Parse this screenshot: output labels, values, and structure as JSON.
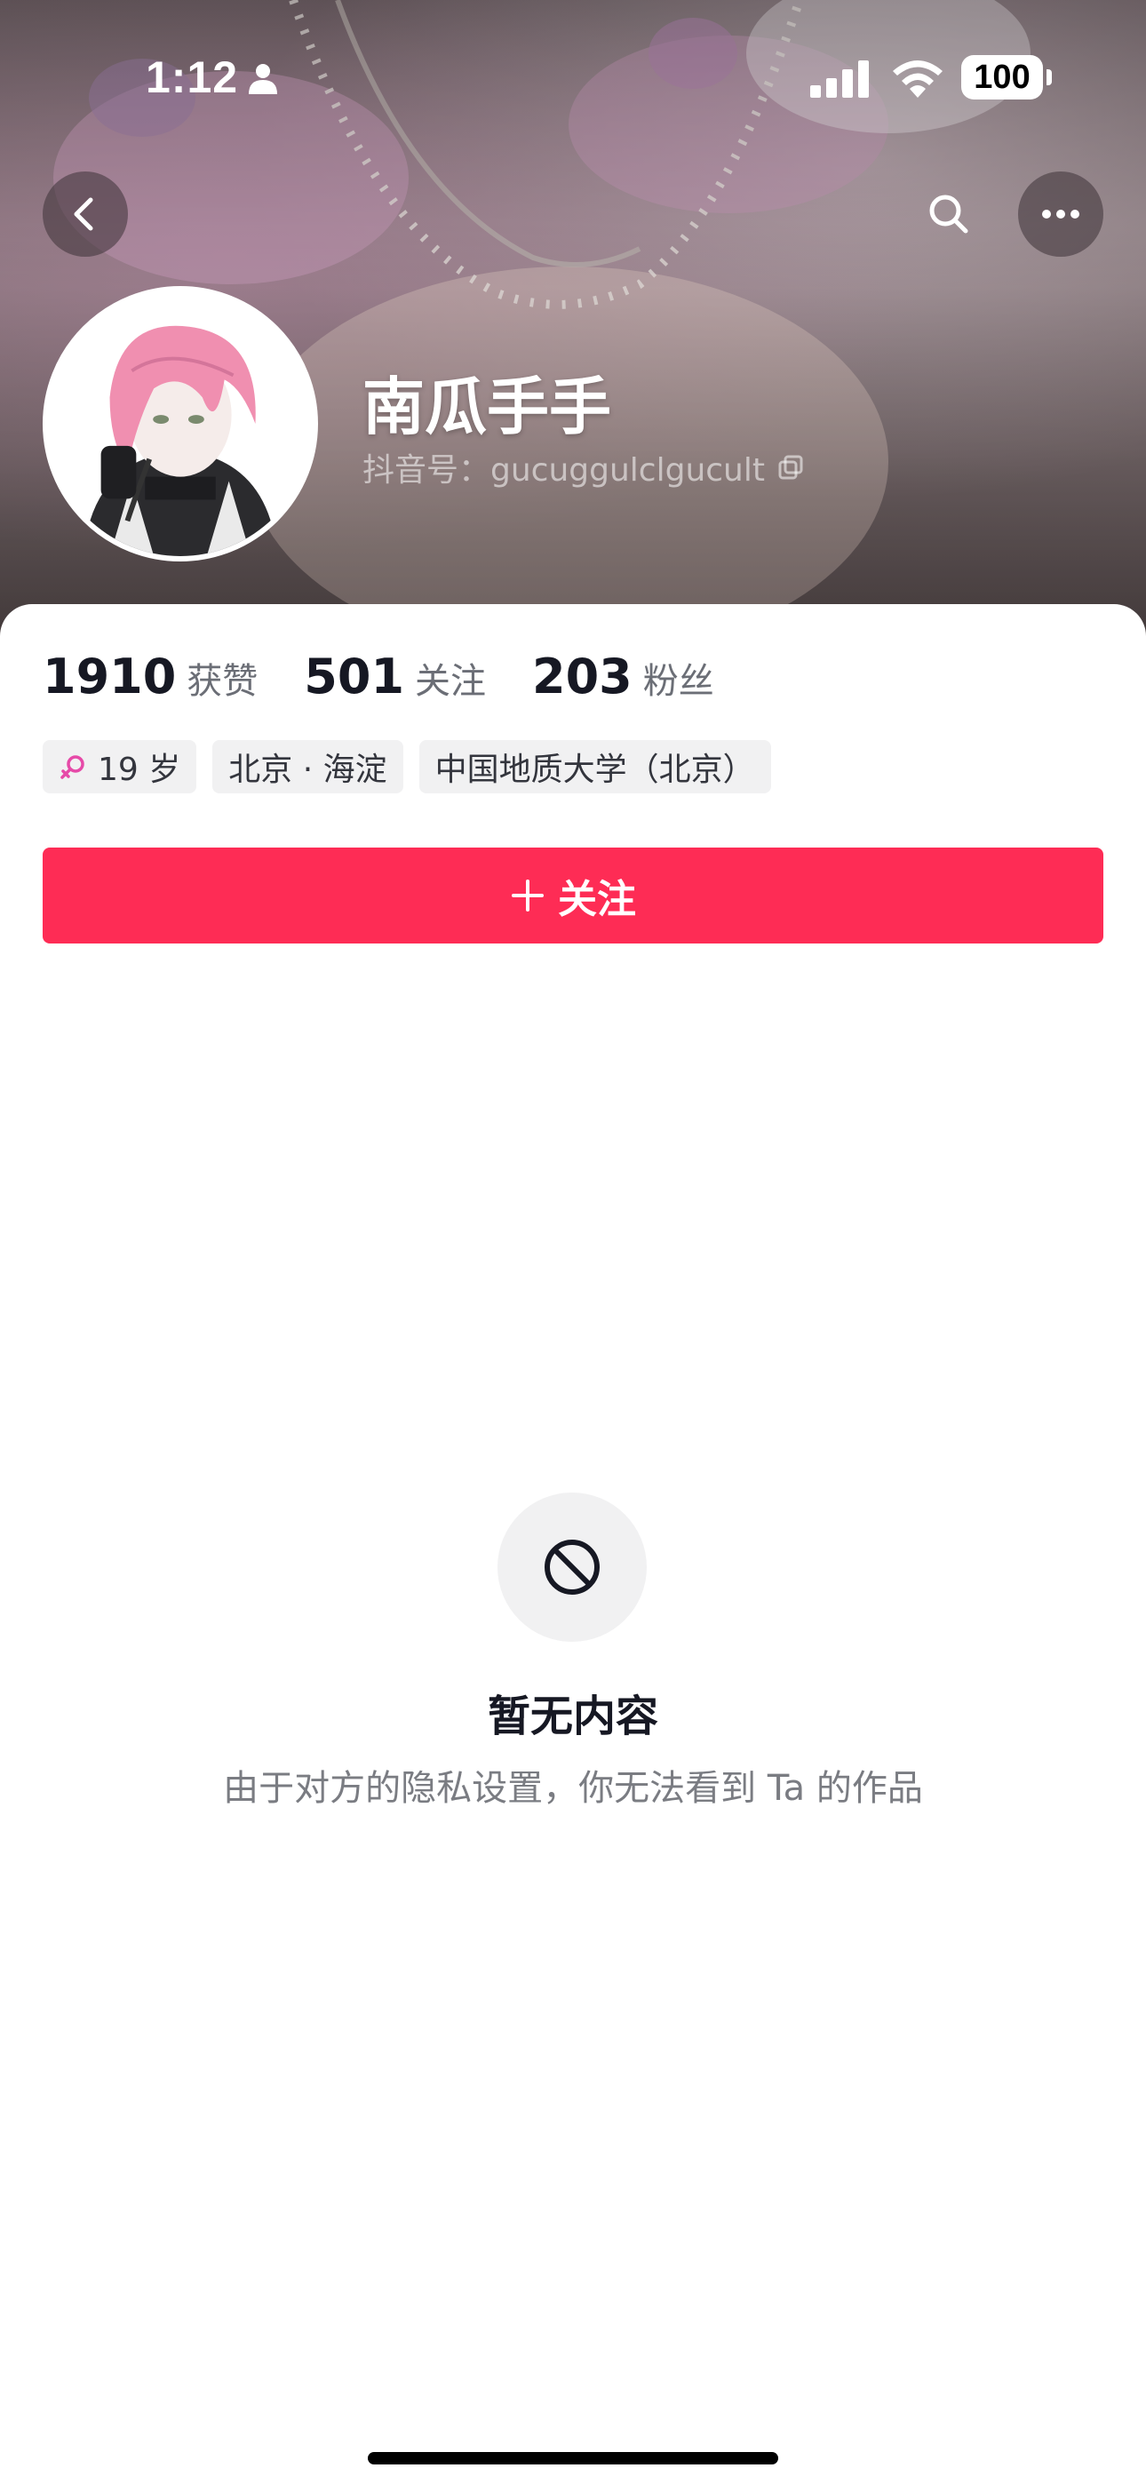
{
  "status_bar": {
    "time": "1:12",
    "battery": "100"
  },
  "header": {
    "back_icon": "chevron-left-icon",
    "search_icon": "search-icon",
    "more_icon": "more-horizontal-icon"
  },
  "profile": {
    "nickname": "南瓜手手",
    "douyin_id": "抖音号：gucuggulclgucult",
    "copy_icon": "copy-icon"
  },
  "stats": [
    {
      "value": "1910",
      "label": "获赞"
    },
    {
      "value": "501",
      "label": "关注"
    },
    {
      "value": "203",
      "label": "粉丝"
    }
  ],
  "tags": {
    "age": "19 岁",
    "location": "北京 · 海淀",
    "school": "中国地质大学（北京）"
  },
  "follow_button": {
    "label": "关注"
  },
  "empty_state": {
    "icon": "forbidden-icon",
    "title": "暂无内容",
    "description": "由于对方的隐私设置，你无法看到 Ta 的作品"
  },
  "colors": {
    "accent": "#fe2c55",
    "gender_female": "#e64aa8",
    "text_primary": "#161823",
    "text_secondary": "#6b6e76"
  }
}
